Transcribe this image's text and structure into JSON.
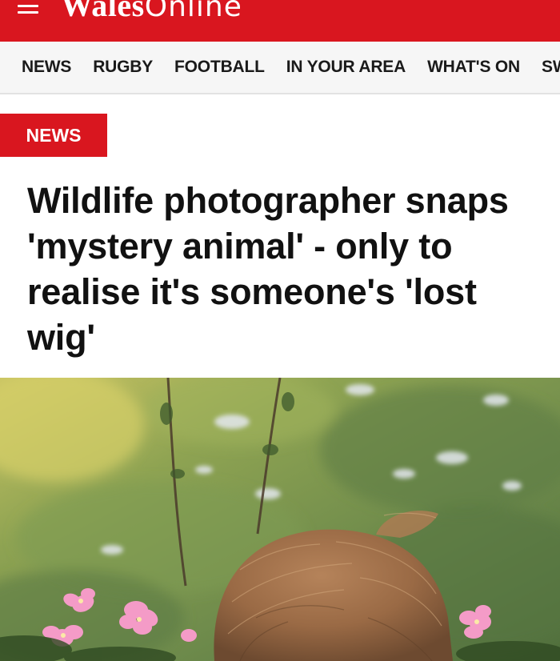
{
  "header": {
    "menu_icon": "hamburger-menu-icon",
    "logo_bold": "Wales",
    "logo_light": "Online",
    "brand_color": "#d9161f"
  },
  "nav": {
    "items": [
      {
        "label": "NEWS"
      },
      {
        "label": "RUGBY"
      },
      {
        "label": "FOOTBALL"
      },
      {
        "label": "IN YOUR AREA"
      },
      {
        "label": "WHAT'S ON"
      },
      {
        "label": "SW"
      }
    ]
  },
  "article": {
    "section": "NEWS",
    "headline": "Wildlife photographer snaps 'mystery animal' - only to realise it's someone's 'lost wig'",
    "photo_subject": "lost wig in meadow with pink mallow flowers"
  }
}
